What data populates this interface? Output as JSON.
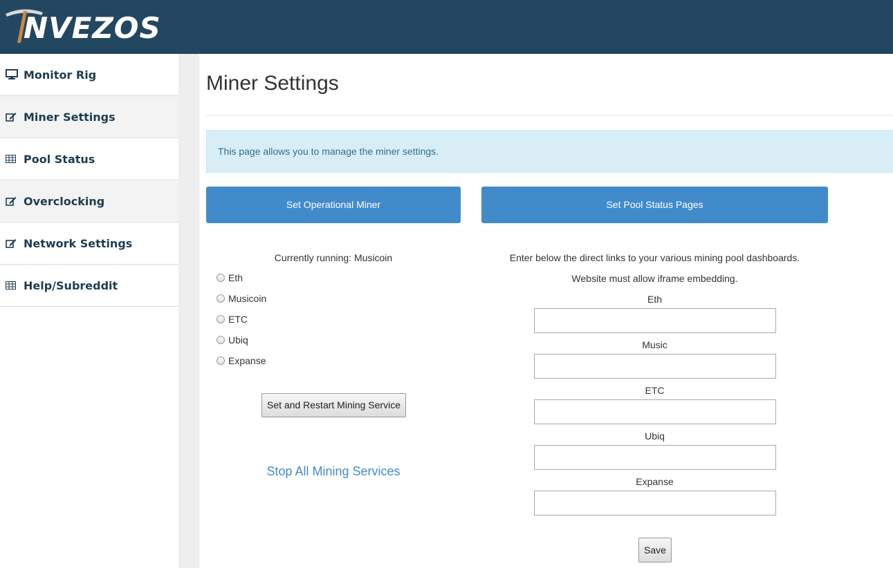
{
  "brand": {
    "logo_text": "NVEZOS"
  },
  "sidebar": {
    "items": [
      {
        "label": "Monitor Rig",
        "icon": "monitor-icon"
      },
      {
        "label": "Miner Settings",
        "icon": "edit-icon"
      },
      {
        "label": "Pool Status",
        "icon": "table-icon"
      },
      {
        "label": "Overclocking",
        "icon": "edit-icon"
      },
      {
        "label": "Network Settings",
        "icon": "edit-icon"
      },
      {
        "label": "Help/Subreddit",
        "icon": "table-icon"
      }
    ]
  },
  "main": {
    "title": "Miner Settings",
    "info": "This page allows you to manage the miner settings.",
    "operational_btn": "Set Operational Miner",
    "pool_btn": "Set Pool Status Pages",
    "running": "Currently running: Musicoin",
    "miners": [
      "Eth",
      "Musicoin",
      "ETC",
      "Ubiq",
      "Expanse"
    ],
    "restart_btn": "Set and Restart Mining Service",
    "stop_link": "Stop All Mining Services",
    "pool_note1": "Enter below the direct links to your various mining pool dashboards.",
    "pool_note2": "Website must allow iframe embedding.",
    "pool_fields": [
      {
        "label": "Eth",
        "value": ""
      },
      {
        "label": "Music",
        "value": ""
      },
      {
        "label": "ETC",
        "value": ""
      },
      {
        "label": "Ubiq",
        "value": ""
      },
      {
        "label": "Expanse",
        "value": ""
      }
    ],
    "save_btn": "Save"
  },
  "colors": {
    "header": "#234760",
    "accent": "#428bca",
    "info_bg": "#d9edf7",
    "info_text": "#31708f"
  }
}
